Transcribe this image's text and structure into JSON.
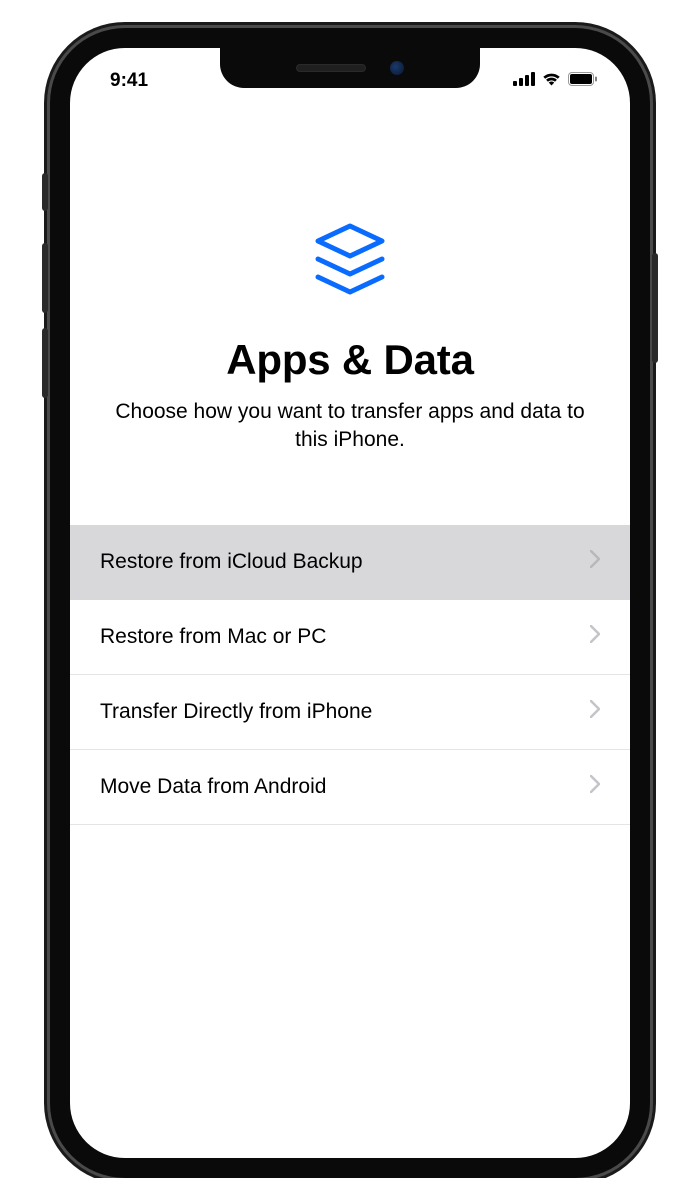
{
  "status_bar": {
    "time": "9:41"
  },
  "header": {
    "title": "Apps & Data",
    "subtitle": "Choose how you want to transfer apps and data to this iPhone."
  },
  "options": [
    {
      "label": "Restore from iCloud Backup",
      "selected": true
    },
    {
      "label": "Restore from Mac or PC",
      "selected": false
    },
    {
      "label": "Transfer Directly from iPhone",
      "selected": false
    },
    {
      "label": "Move Data from Android",
      "selected": false
    }
  ],
  "colors": {
    "accent": "#0a6bff"
  }
}
